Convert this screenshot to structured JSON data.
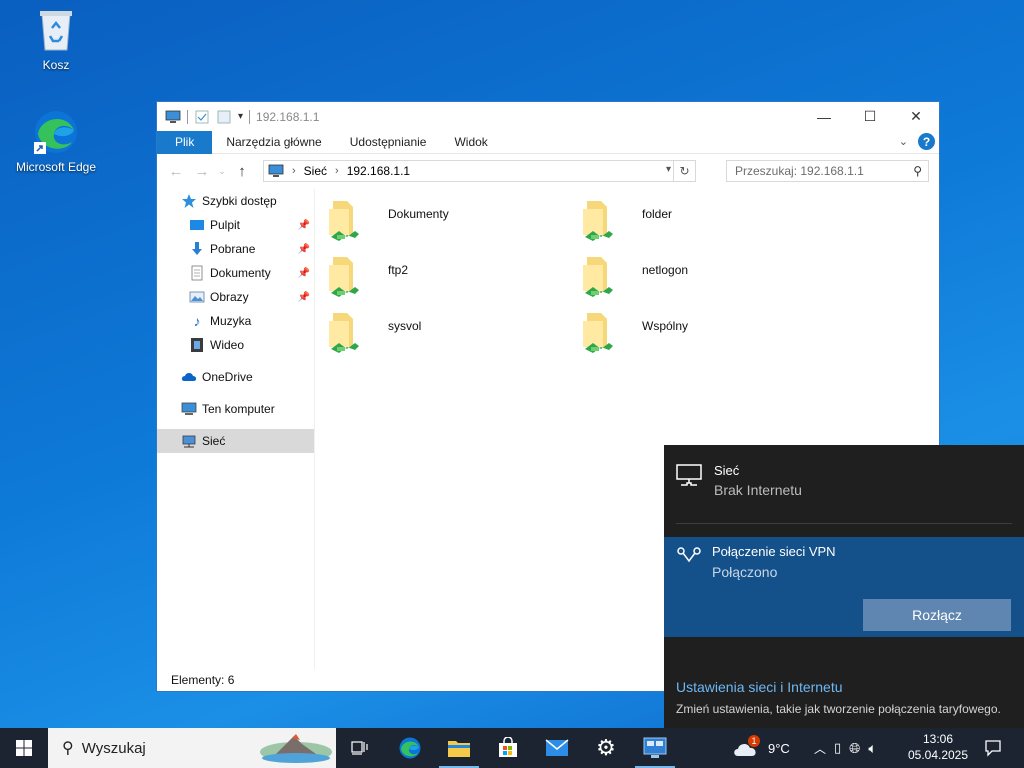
{
  "desktop": {
    "icons": [
      {
        "label": "Kosz",
        "icon": "recycle-bin-icon"
      },
      {
        "label": "Microsoft Edge",
        "icon": "edge-icon"
      }
    ]
  },
  "window": {
    "title": "192.168.1.1",
    "ribbon_tabs": [
      "Plik",
      "Narzędzia główne",
      "Udostępnianie",
      "Widok"
    ],
    "address": {
      "crumbs": [
        "Sieć",
        "192.168.1.1"
      ]
    },
    "search_placeholder": "Przeszukaj: 192.168.1.1",
    "nav": {
      "quick_access": "Szybki dostęp",
      "items": [
        "Pulpit",
        "Pobrane",
        "Dokumenty",
        "Obrazy",
        "Muzyka",
        "Wideo"
      ],
      "onedrive": "OneDrive",
      "this_pc": "Ten komputer",
      "network": "Sieć"
    },
    "shares": [
      "Dokumenty",
      "folder",
      "ftp2",
      "netlogon",
      "sysvol",
      "Wspólny"
    ],
    "status": "Elementy: 6"
  },
  "flyout": {
    "network_name": "Sieć",
    "network_status": "Brak Internetu",
    "vpn_name": "Połączenie sieci VPN",
    "vpn_status": "Połączono",
    "disconnect_label": "Rozłącz",
    "settings_link": "Ustawienia sieci i Internetu",
    "settings_desc": "Zmień ustawienia, takie jak tworzenie połączenia taryfowego."
  },
  "taskbar": {
    "search_placeholder": "Wyszukaj",
    "weather_temp": "9°C",
    "weather_badge": "1",
    "time": "13:06",
    "date": "05.04.2025"
  },
  "colors": {
    "accent": "#1979ca",
    "vpn_bg": "#14508a",
    "flyout_bg": "#1f1f1f",
    "taskbar_bg": "#1b2430"
  }
}
